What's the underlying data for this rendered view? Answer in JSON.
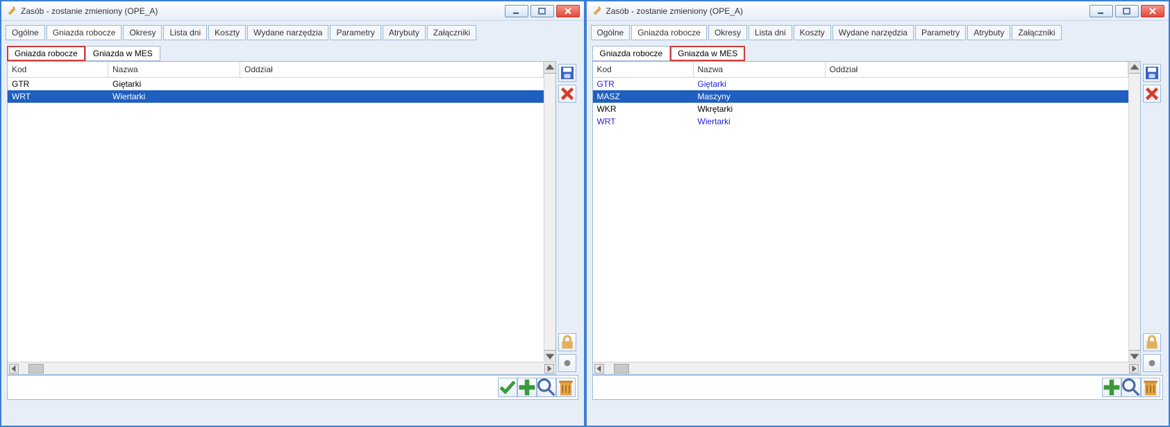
{
  "windows": [
    {
      "title": "Zasób - zostanie zmieniony  (OPE_A)",
      "tabs": [
        "Ogólne",
        "Gniazda robocze",
        "Okresy",
        "Lista dni",
        "Koszty",
        "Wydane narzędzia",
        "Parametry",
        "Atrybuty",
        "Załączniki"
      ],
      "active_tab": 1,
      "subtabs": [
        "Gniazda robocze",
        "Gniazda w MES"
      ],
      "highlighted_subtab": 0,
      "columns": [
        "Kod",
        "Nazwa",
        "Oddział"
      ],
      "rows": [
        {
          "kod": "GTR",
          "nazwa": "Giętarki",
          "oddzial": "",
          "selected": false,
          "bluefont": false
        },
        {
          "kod": "WRT",
          "nazwa": "Wiertarki",
          "oddzial": "",
          "selected": true,
          "bluefont": false
        }
      ],
      "show_check_btn": true,
      "show_save_side": true
    },
    {
      "title": "Zasób - zostanie zmieniony  (OPE_A)",
      "tabs": [
        "Ogólne",
        "Gniazda robocze",
        "Okresy",
        "Lista dni",
        "Koszty",
        "Wydane narzędzia",
        "Parametry",
        "Atrybuty",
        "Załączniki"
      ],
      "active_tab": 1,
      "subtabs": [
        "Gniazda robocze",
        "Gniazda w MES"
      ],
      "highlighted_subtab": 1,
      "columns": [
        "Kod",
        "Nazwa",
        "Oddział"
      ],
      "rows": [
        {
          "kod": "GTR",
          "nazwa": "Giętarki",
          "oddzial": "",
          "selected": false,
          "bluefont": true
        },
        {
          "kod": "MASZ",
          "nazwa": "Maszyny",
          "oddzial": "",
          "selected": true,
          "bluefont": false
        },
        {
          "kod": "WKR",
          "nazwa": "Wkrętarki",
          "oddzial": "",
          "selected": false,
          "bluefont": false
        },
        {
          "kod": "WRT",
          "nazwa": "Wiertarki",
          "oddzial": "",
          "selected": false,
          "bluefont": true
        }
      ],
      "show_check_btn": false,
      "show_save_side": true
    }
  ],
  "icons": {
    "wrench": "wrench-icon"
  }
}
